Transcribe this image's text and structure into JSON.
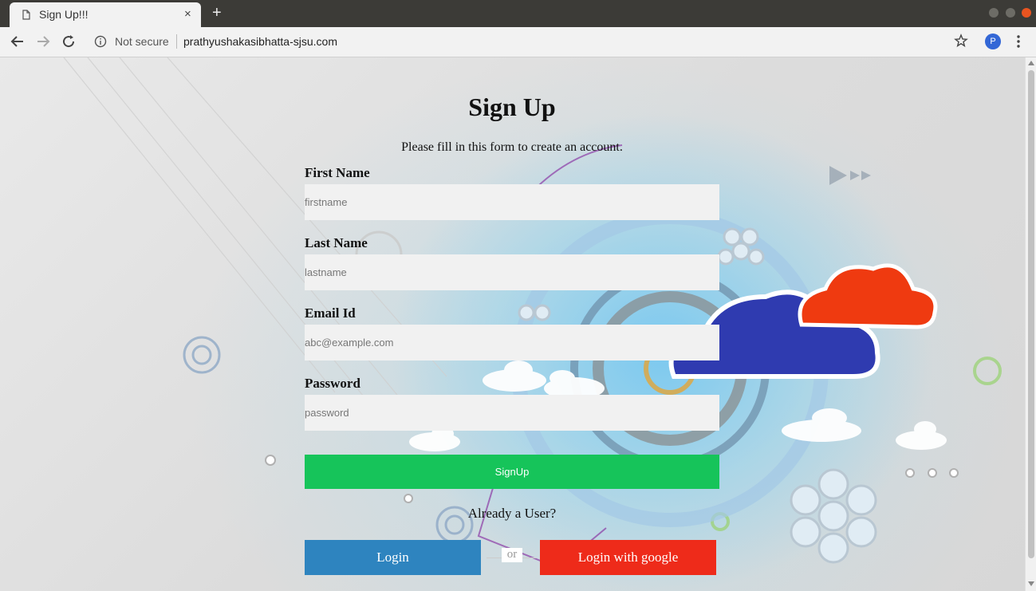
{
  "browser": {
    "tab_title": "Sign Up!!!",
    "tab_close": "×",
    "new_tab": "+",
    "security_label": "Not secure",
    "url": "prathyushakasibhatta-sjsu.com",
    "profile_initial": "P"
  },
  "page": {
    "title": "Sign Up",
    "subtitle": "Please fill in this form to create an account.",
    "fields": [
      {
        "label": "First Name",
        "placeholder": "firstname",
        "value": ""
      },
      {
        "label": "Last Name",
        "placeholder": "lastname",
        "value": ""
      },
      {
        "label": "Email Id",
        "placeholder": "abc@example.com",
        "value": ""
      },
      {
        "label": "Password",
        "placeholder": "password",
        "value": ""
      }
    ],
    "signup_label": "SignUp",
    "already_user": "Already a User?",
    "login_label": "Login",
    "or_label": "or",
    "google_label": "Login with google"
  },
  "colors": {
    "signup": "#16c45a",
    "login": "#2e84bf",
    "google": "#ee2b1a",
    "input_bg": "#f1f1f1"
  }
}
